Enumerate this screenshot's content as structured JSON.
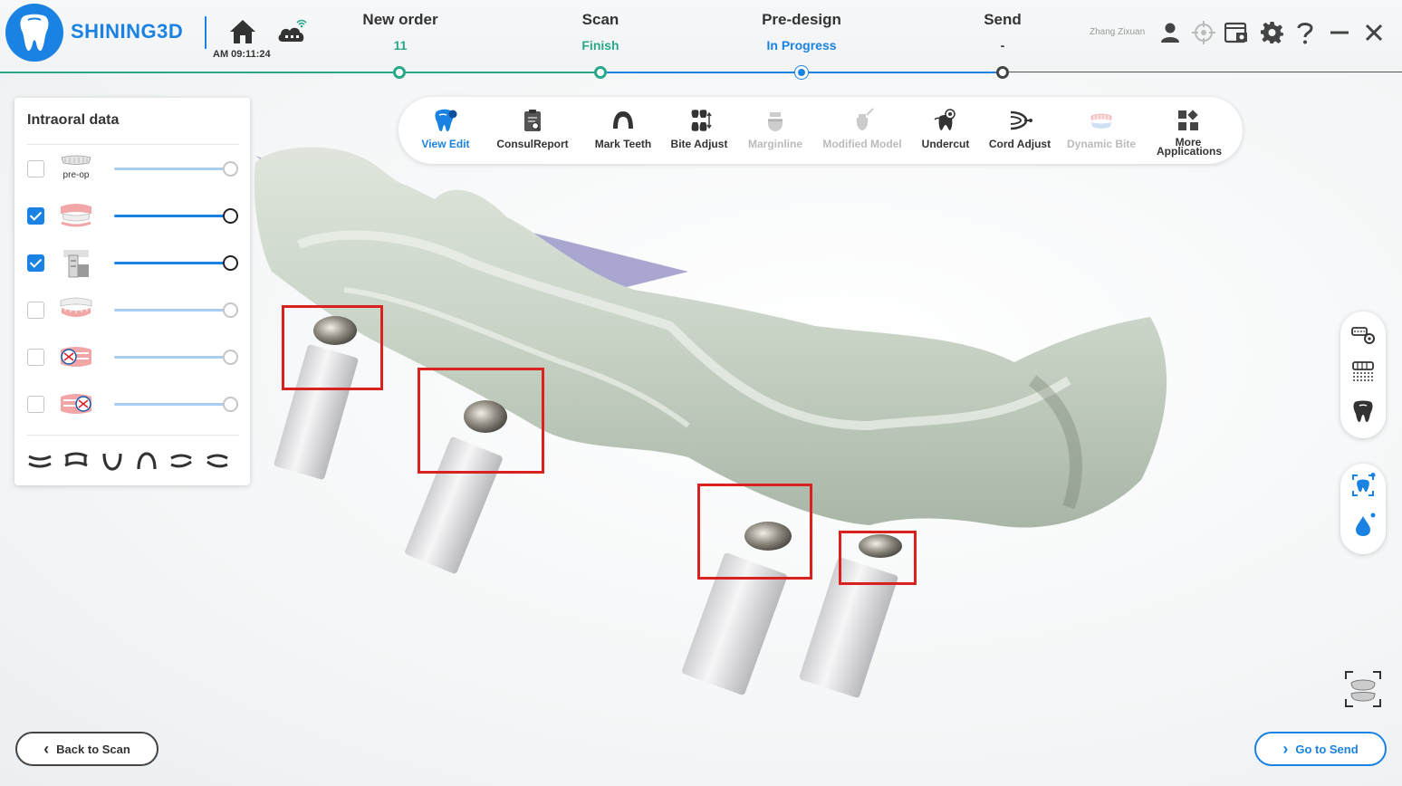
{
  "app": {
    "brand": "SHINING3D",
    "clock": "AM 09:11:24",
    "user_name": "Zhang Zixuan"
  },
  "steps": [
    {
      "title": "New order",
      "status": "11",
      "status_color": "#2aa88a",
      "state": "done"
    },
    {
      "title": "Scan",
      "status": "Finish",
      "status_color": "#2aa88a",
      "state": "done"
    },
    {
      "title": "Pre-design",
      "status": "In Progress",
      "status_color": "#1a82e2",
      "state": "current"
    },
    {
      "title": "Send",
      "status": "-",
      "status_color": "#333333",
      "state": "pending"
    }
  ],
  "header_icons": [
    "user-icon",
    "crosshair-icon",
    "screenshot-window-icon",
    "gear-icon",
    "help-icon",
    "minimize-icon",
    "close-icon"
  ],
  "left_panel": {
    "title": "Intraoral data",
    "layers": [
      {
        "name": "pre-op",
        "thumb_label": "pre-op",
        "checked": false,
        "opacity": 1.0
      },
      {
        "name": "upper-jaw",
        "thumb_label": "",
        "checked": true,
        "opacity": 1.0
      },
      {
        "name": "scan-body",
        "thumb_label": "",
        "checked": true,
        "opacity": 1.0
      },
      {
        "name": "lower-jaw",
        "thumb_label": "",
        "checked": false,
        "opacity": 1.0
      },
      {
        "name": "upper-bite",
        "thumb_label": "",
        "checked": false,
        "opacity": 1.0
      },
      {
        "name": "lower-bite",
        "thumb_label": "",
        "checked": false,
        "opacity": 1.0
      }
    ],
    "view_icons": [
      "view-front-icon",
      "view-back-icon",
      "view-lower-icon",
      "view-upper-icon",
      "view-left-icon",
      "view-right-icon"
    ]
  },
  "toolbar": {
    "tools": [
      {
        "label": "View Edit",
        "icon": "tooth-edit-icon",
        "state": "active"
      },
      {
        "label": "ConsulReport",
        "icon": "report-icon",
        "state": "normal"
      },
      {
        "label": "Mark Teeth",
        "icon": "mark-teeth-icon",
        "state": "normal"
      },
      {
        "label": "Bite Adjust",
        "icon": "bite-adjust-icon",
        "state": "normal"
      },
      {
        "label": "Marginline",
        "icon": "marginline-icon",
        "state": "disabled"
      },
      {
        "label": "Modified Model",
        "icon": "modified-model-icon",
        "state": "disabled"
      },
      {
        "label": "Undercut",
        "icon": "undercut-icon",
        "state": "normal"
      },
      {
        "label": "Cord Adjust",
        "icon": "cord-adjust-icon",
        "state": "normal"
      },
      {
        "label": "Dynamic Bite",
        "icon": "dynamic-bite-icon",
        "state": "disabled"
      },
      {
        "label": "More Applications",
        "icon": "more-applications-icon",
        "state": "normal"
      }
    ]
  },
  "side_tools": {
    "group1": [
      "scan-settings-icon",
      "grid-teeth-icon",
      "tooth-icon"
    ],
    "group2": [
      "ai-tooth-icon",
      "water-drop-icon"
    ]
  },
  "buttons": {
    "back_label": "Back to Scan",
    "send_label": "Go to Send"
  },
  "colors": {
    "accent": "#1a82e2",
    "done": "#2aa88a",
    "highlight": "#d9221f"
  }
}
